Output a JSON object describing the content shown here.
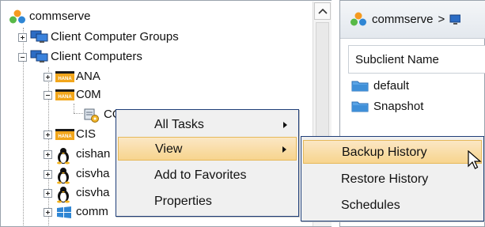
{
  "tree": {
    "root": "commserve",
    "groups_label": "Client Computer Groups",
    "clients_label": "Client Computers",
    "nodes": {
      "ana": "ANA",
      "com": "C0M",
      "com_child": "CO",
      "cis": "CIS",
      "cishan": "cishan",
      "cisvhan": "cisvha",
      "cisvhan2": "cisvha",
      "comm": "comm"
    },
    "hana_badge": "HANA"
  },
  "right_pane": {
    "breadcrumb_root": "commserve",
    "breadcrumb_sep": ">",
    "column_header": "Subclient Name",
    "subclients": [
      "default",
      "Snapshot"
    ]
  },
  "context_menu": {
    "items": [
      "All Tasks",
      "View",
      "Add to Favorites",
      "Properties"
    ]
  },
  "submenu": {
    "items": [
      "Backup History",
      "Restore History",
      "Schedules"
    ]
  },
  "colors": {
    "menu_border": "#1f3e78",
    "highlight": "#f7d48e",
    "folder_blue": "#3f8fd8",
    "hana_orange": "#f2a61b"
  }
}
